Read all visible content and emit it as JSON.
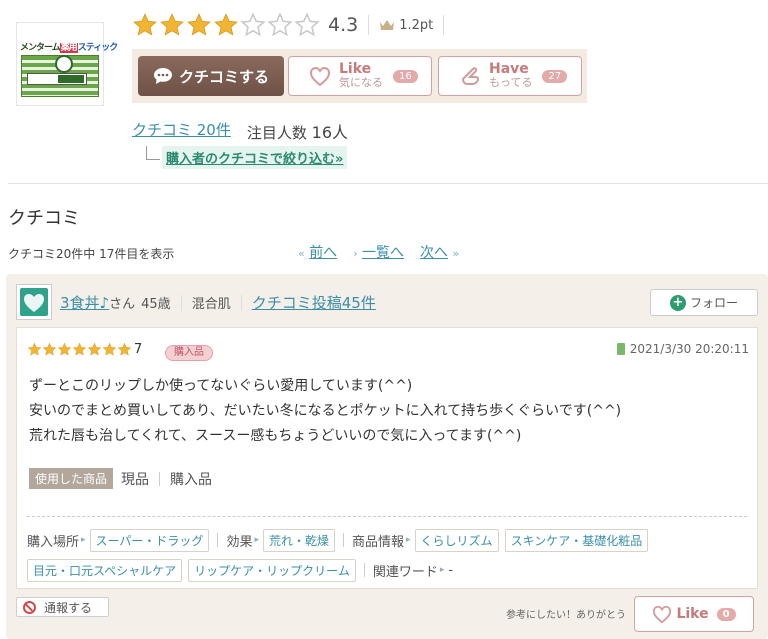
{
  "product": {
    "thumb_title": "メンターム 薬用スティック",
    "thumb_title_parts": {
      "brand": "メンターム",
      "medicated": "薬用",
      "type": "スティック"
    },
    "rating": "4.3",
    "rating_stars": 4,
    "rating_max": 7,
    "points": "1.2pt"
  },
  "actions": {
    "kuchikomi_label": "クチコミする",
    "like": {
      "main": "Like",
      "sub": "気になる",
      "count": "16"
    },
    "have": {
      "main": "Have",
      "sub": "もってる",
      "count": "27"
    }
  },
  "summary": {
    "review_count_link": "クチコミ 20件",
    "attention_label": "注目人数",
    "attention_count": "16人",
    "filter_link": "購入者のクチコミで絞り込む»"
  },
  "section": {
    "title": "クチコミ",
    "paging_info": "クチコミ20件中 17件目を表示",
    "prev": "前へ",
    "list": "一覧へ",
    "next": "次へ"
  },
  "review": {
    "user_name": "3食丼♪",
    "honorific": "さん",
    "age": "45歳",
    "skin_type": "混合肌",
    "posts_link": "クチコミ投稿45件",
    "follow_label": "フォロー",
    "star_count": 7,
    "score": "7",
    "purchase_badge": "購入品",
    "date": "2021/3/30 20:20:11",
    "lines": [
      "ずーとこのリップしか使ってないぐらい愛用しています(^^)",
      "安いのでまとめ買いしてあり、だいたい冬になるとポケットに入れて持ち歩くぐらいです(^^)",
      "荒れた唇も治してくれて、スースー感もちょうどいいので気に入ってます(^^)"
    ],
    "used_tag": "使用した商品",
    "used_items": [
      "現品",
      "購入品"
    ],
    "place_label": "購入場所",
    "place_value": "スーパー・ドラッグ",
    "effect_label": "効果",
    "effect_value": "荒れ・乾燥",
    "info_label": "商品情報",
    "info_values": [
      "くらしリズム",
      "スキンケア・基礎化粧品",
      "目元・口元スペシャルケア",
      "リップケア・リップクリーム"
    ],
    "word_label": "関連ワード",
    "word_value": "-",
    "report_label": "通報する",
    "helpful_text": "参考にしたい！ありがとう",
    "like_label": "Like",
    "like_count": "0"
  },
  "colors": {
    "star": "#f2b533",
    "link": "#3a8fa8",
    "action_bar": "#f4ebe3",
    "kuchikomi_btn": "#6e5146",
    "pink": "#c87a7a"
  }
}
